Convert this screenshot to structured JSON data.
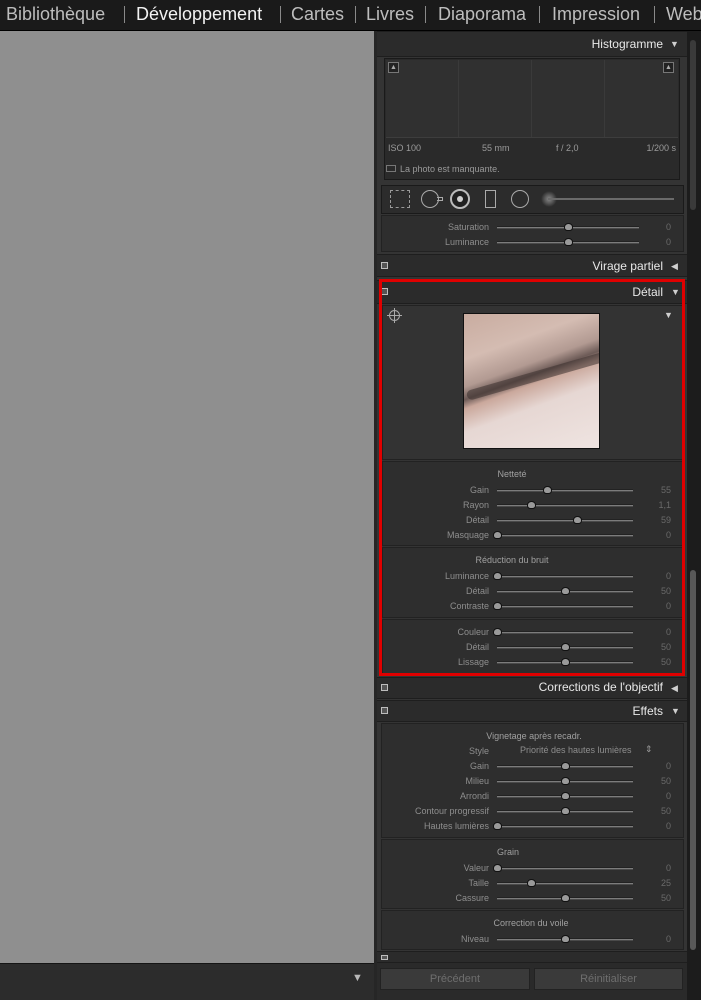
{
  "modules": [
    {
      "label": "Bibliothèque",
      "active": false
    },
    {
      "label": "Développement",
      "active": true
    },
    {
      "label": "Cartes",
      "active": false
    },
    {
      "label": "Livres",
      "active": false
    },
    {
      "label": "Diaporama",
      "active": false
    },
    {
      "label": "Impression",
      "active": false
    },
    {
      "label": "Web",
      "active": false
    }
  ],
  "histogram": {
    "title": "Histogramme",
    "iso": "ISO 100",
    "focal": "55 mm",
    "aperture": "f / 2,0",
    "shutter": "1/200 s",
    "missing": "La photo est manquante."
  },
  "tools": [
    "crop-overlay-icon",
    "spot-removal-icon",
    "red-eye-icon",
    "graduated-filter-icon",
    "radial-filter-icon",
    "brush-icon"
  ],
  "split_tone_partial": {
    "rows": [
      {
        "label": "Saturation",
        "value": "0",
        "pos": 0.5
      },
      {
        "label": "Luminance",
        "value": "0",
        "pos": 0.5
      }
    ]
  },
  "virage_partiel": {
    "title": "Virage partiel"
  },
  "detail": {
    "title": "Détail",
    "nettete": {
      "title": "Netteté",
      "rows": [
        {
          "label": "Gain",
          "value": "55",
          "pos": 0.37
        },
        {
          "label": "Rayon",
          "value": "1,1",
          "pos": 0.25
        },
        {
          "label": "Détail",
          "value": "59",
          "pos": 0.59
        },
        {
          "label": "Masquage",
          "value": "0",
          "pos": 0.0
        }
      ]
    },
    "bruit": {
      "title": "Réduction du bruit",
      "rows": [
        {
          "label": "Luminance",
          "value": "0",
          "pos": 0.0
        },
        {
          "label": "Détail",
          "value": "50",
          "pos": 0.5
        },
        {
          "label": "Contraste",
          "value": "0",
          "pos": 0.0
        }
      ]
    },
    "couleur": {
      "rows": [
        {
          "label": "Couleur",
          "value": "0",
          "pos": 0.0
        },
        {
          "label": "Détail",
          "value": "50",
          "pos": 0.5
        },
        {
          "label": "Lissage",
          "value": "50",
          "pos": 0.5
        }
      ]
    }
  },
  "corrections": {
    "title": "Corrections de l'objectif"
  },
  "effets": {
    "title": "Effets",
    "vignette": {
      "title": "Vignetage après recadr.",
      "style_label": "Style",
      "style_value": "Priorité des hautes lumières",
      "rows": [
        {
          "label": "Gain",
          "value": "0",
          "pos": 0.5
        },
        {
          "label": "Milieu",
          "value": "50",
          "pos": 0.5
        },
        {
          "label": "Arrondi",
          "value": "0",
          "pos": 0.5
        },
        {
          "label": "Contour progressif",
          "value": "50",
          "pos": 0.5
        },
        {
          "label": "Hautes lumières",
          "value": "0",
          "pos": 0.0
        }
      ]
    },
    "grain": {
      "title": "Grain",
      "rows": [
        {
          "label": "Valeur",
          "value": "0",
          "pos": 0.0
        },
        {
          "label": "Taille",
          "value": "25",
          "pos": 0.25
        },
        {
          "label": "Cassure",
          "value": "50",
          "pos": 0.5
        }
      ]
    },
    "voile": {
      "title": "Correction du voile",
      "rows": [
        {
          "label": "Niveau",
          "value": "0",
          "pos": 0.5
        }
      ]
    }
  },
  "bottom": {
    "previous": "Précédent",
    "reset": "Réinitialiser"
  }
}
